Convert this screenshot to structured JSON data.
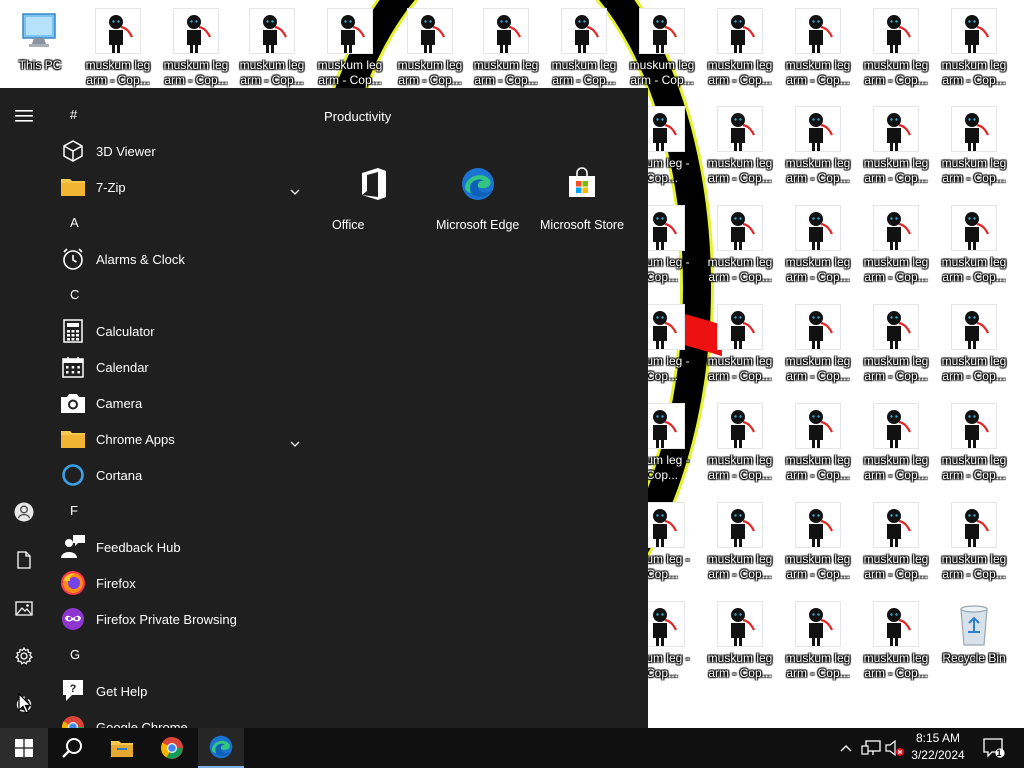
{
  "desktop": {
    "this_pc_label": "This PC",
    "recycle_bin_label": "Recycle Bin",
    "file_icon_label": "muskum leg arm - Cop...",
    "file_icon_label_clipped": "skum leg\n- Cop..."
  },
  "start_menu": {
    "section_title": "Productivity",
    "apps": [
      {
        "kind": "letter",
        "text": "#"
      },
      {
        "kind": "app",
        "name": "3D Viewer",
        "icon": "cube-icon"
      },
      {
        "kind": "app",
        "name": "7-Zip",
        "icon": "folder-icon",
        "expandable": true
      },
      {
        "kind": "letter",
        "text": "A"
      },
      {
        "kind": "app",
        "name": "Alarms & Clock",
        "icon": "alarm-clock-icon"
      },
      {
        "kind": "letter",
        "text": "C"
      },
      {
        "kind": "app",
        "name": "Calculator",
        "icon": "calculator-icon"
      },
      {
        "kind": "app",
        "name": "Calendar",
        "icon": "calendar-icon"
      },
      {
        "kind": "app",
        "name": "Camera",
        "icon": "camera-icon"
      },
      {
        "kind": "app",
        "name": "Chrome Apps",
        "icon": "folder-icon",
        "expandable": true
      },
      {
        "kind": "app",
        "name": "Cortana",
        "icon": "cortana-ring-icon"
      },
      {
        "kind": "letter",
        "text": "F"
      },
      {
        "kind": "app",
        "name": "Feedback Hub",
        "icon": "feedback-person-icon"
      },
      {
        "kind": "app",
        "name": "Firefox",
        "icon": "firefox-icon"
      },
      {
        "kind": "app",
        "name": "Firefox Private Browsing",
        "icon": "firefox-private-icon"
      },
      {
        "kind": "letter",
        "text": "G"
      },
      {
        "kind": "app",
        "name": "Get Help",
        "icon": "help-bubble-icon"
      },
      {
        "kind": "app",
        "name": "Google Chrome",
        "icon": "chrome-icon"
      }
    ],
    "tiles": [
      {
        "label": "Office",
        "icon": "office-icon",
        "color": "#d83b01"
      },
      {
        "label": "Microsoft Edge",
        "icon": "edge-icon",
        "color": "#333333"
      },
      {
        "label": "Microsoft Store",
        "icon": "store-bag-icon",
        "color": "#333333"
      }
    ],
    "rail": [
      "hamburger-menu-icon",
      "user-account-icon",
      "documents-icon",
      "pictures-icon",
      "settings-gear-icon",
      "power-icon"
    ]
  },
  "taskbar": {
    "time": "8:15 AM",
    "date": "3/22/2024",
    "notification_count": "1",
    "pinned": [
      "windows-start-icon",
      "search-icon",
      "file-explorer-icon",
      "chrome-icon",
      "edge-icon"
    ]
  },
  "colors": {
    "start_bg": "#1f1f1f",
    "office_tile": "#d83b01",
    "tile_bg": "#333333",
    "taskbar": "#101010",
    "ring_yellow": "#e5f230",
    "scarf_red": "#ee1111"
  }
}
